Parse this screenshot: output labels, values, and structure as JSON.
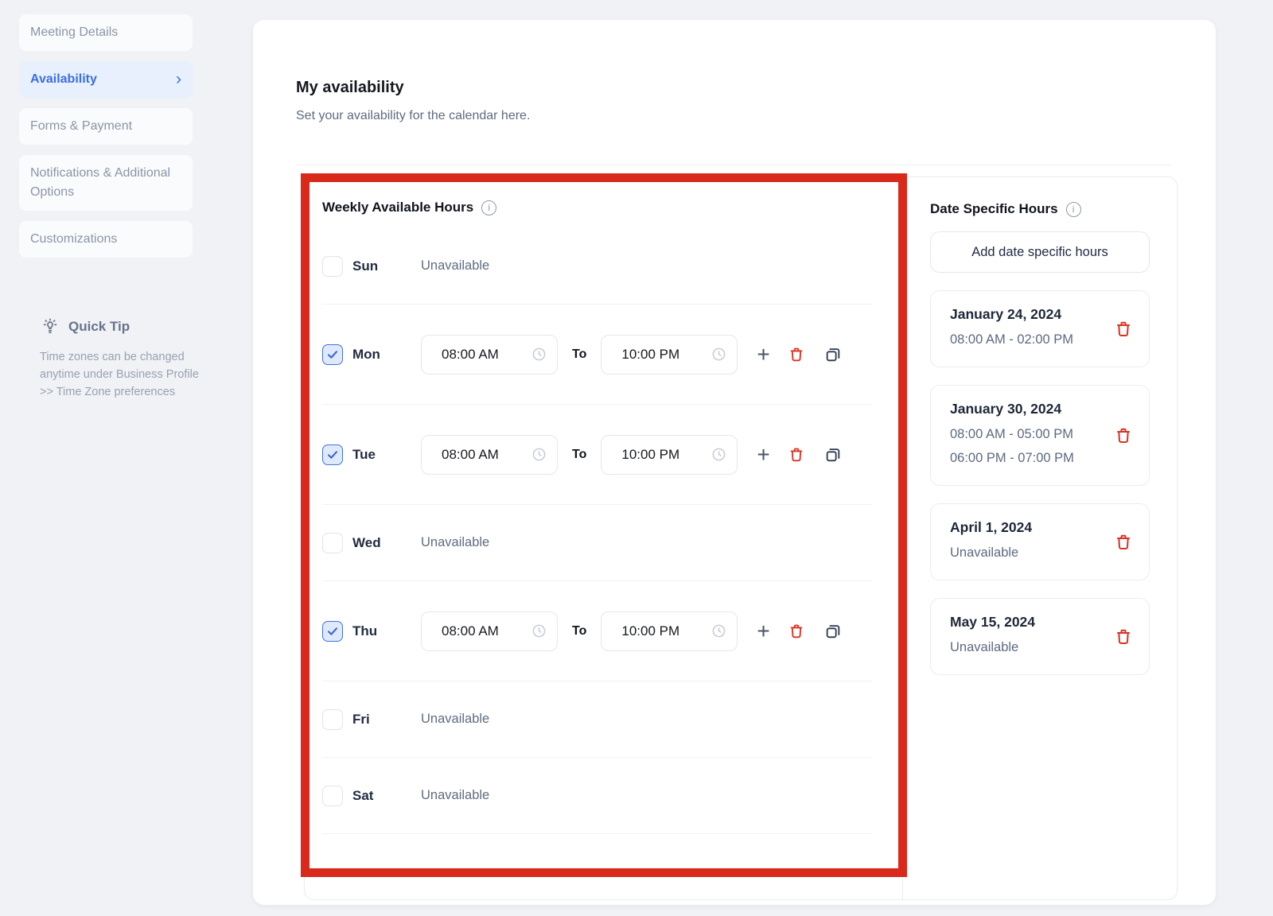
{
  "icons": {
    "chevron_right": "›",
    "plus": "+",
    "info": "i"
  },
  "annotation_color": "#d8291b",
  "sidebar": {
    "items": [
      {
        "label": "Meeting Details",
        "active": false
      },
      {
        "label": "Availability",
        "active": true
      },
      {
        "label": "Forms & Payment",
        "active": false
      },
      {
        "label": "Notifications & Additional Options",
        "active": false
      },
      {
        "label": "Customizations",
        "active": false
      }
    ],
    "quick_tip": {
      "title": "Quick Tip",
      "body": "Time zones can be changed anytime under Business Profile >> Time Zone preferences"
    }
  },
  "main": {
    "title": "My availability",
    "subtitle": "Set your availability for the calendar here.",
    "weekly": {
      "heading": "Weekly Available Hours",
      "to_label": "To",
      "unavailable_label": "Unavailable",
      "days": [
        {
          "day": "Sun",
          "checked": false,
          "start": "",
          "end": ""
        },
        {
          "day": "Mon",
          "checked": true,
          "start": "08:00 AM",
          "end": "10:00 PM"
        },
        {
          "day": "Tue",
          "checked": true,
          "start": "08:00 AM",
          "end": "10:00 PM"
        },
        {
          "day": "Wed",
          "checked": false,
          "start": "",
          "end": ""
        },
        {
          "day": "Thu",
          "checked": true,
          "start": "08:00 AM",
          "end": "10:00 PM"
        },
        {
          "day": "Fri",
          "checked": false,
          "start": "",
          "end": ""
        },
        {
          "day": "Sat",
          "checked": false,
          "start": "",
          "end": ""
        }
      ]
    },
    "date_specific": {
      "heading": "Date Specific Hours",
      "add_button": "Add date specific hours",
      "entries": [
        {
          "date": "January 24, 2024",
          "times": [
            "08:00 AM - 02:00 PM"
          ]
        },
        {
          "date": "January 30, 2024",
          "times": [
            "08:00 AM - 05:00 PM",
            "06:00 PM - 07:00 PM"
          ]
        },
        {
          "date": "April 1, 2024",
          "times": [
            "Unavailable"
          ]
        },
        {
          "date": "May 15, 2024",
          "times": [
            "Unavailable"
          ]
        }
      ]
    }
  }
}
